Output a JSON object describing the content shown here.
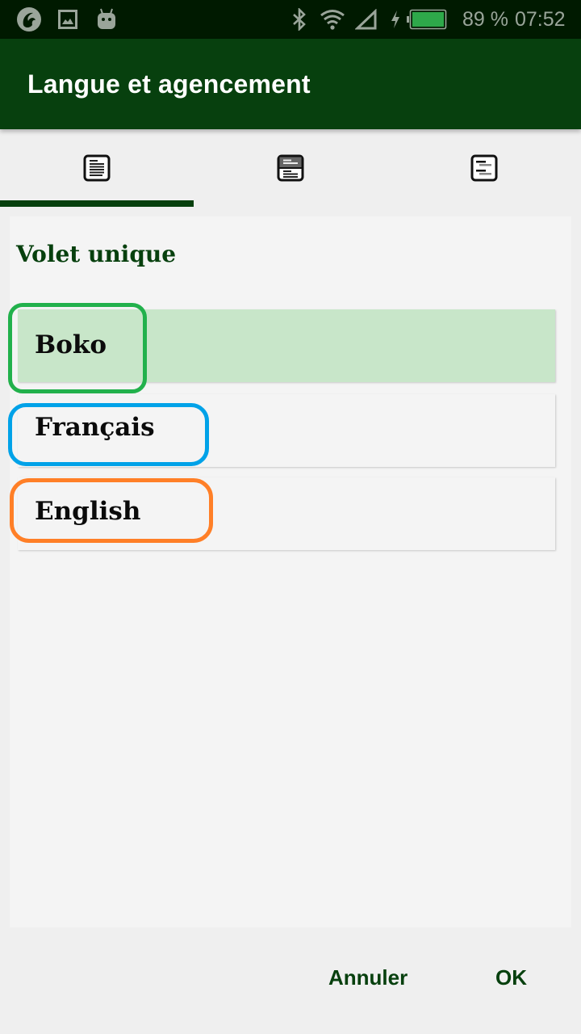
{
  "status_bar": {
    "left_icons": [
      "app-logo-icon",
      "image-icon",
      "android-icon"
    ],
    "right_icons": [
      "bluetooth-icon",
      "wifi-icon",
      "cell-signal-icon",
      "charging-icon",
      "battery-icon"
    ],
    "battery_percent": "89 %",
    "battery_level": 0.89,
    "time": "07:52"
  },
  "app_bar": {
    "title": "Langue et agencement"
  },
  "tabs": [
    {
      "icon": "single-pane-icon",
      "selected": true
    },
    {
      "icon": "two-pane-icon",
      "selected": false
    },
    {
      "icon": "interlinear-icon",
      "selected": false
    }
  ],
  "content": {
    "section_title": "Volet unique",
    "languages": [
      {
        "label": "Boko",
        "selected": true
      },
      {
        "label": "Français",
        "selected": false
      },
      {
        "label": "English",
        "selected": false
      }
    ]
  },
  "highlights": {
    "colors": [
      "#22b14c",
      "#00a2e8",
      "#ff7f27"
    ]
  },
  "colors": {
    "primary": "#07400e",
    "selected_bg": "#c8e6c9",
    "status_bar_bg": "#001a00",
    "battery_fill": "#2ea84a"
  },
  "dialog": {
    "cancel_label": "Annuler",
    "ok_label": "OK"
  }
}
